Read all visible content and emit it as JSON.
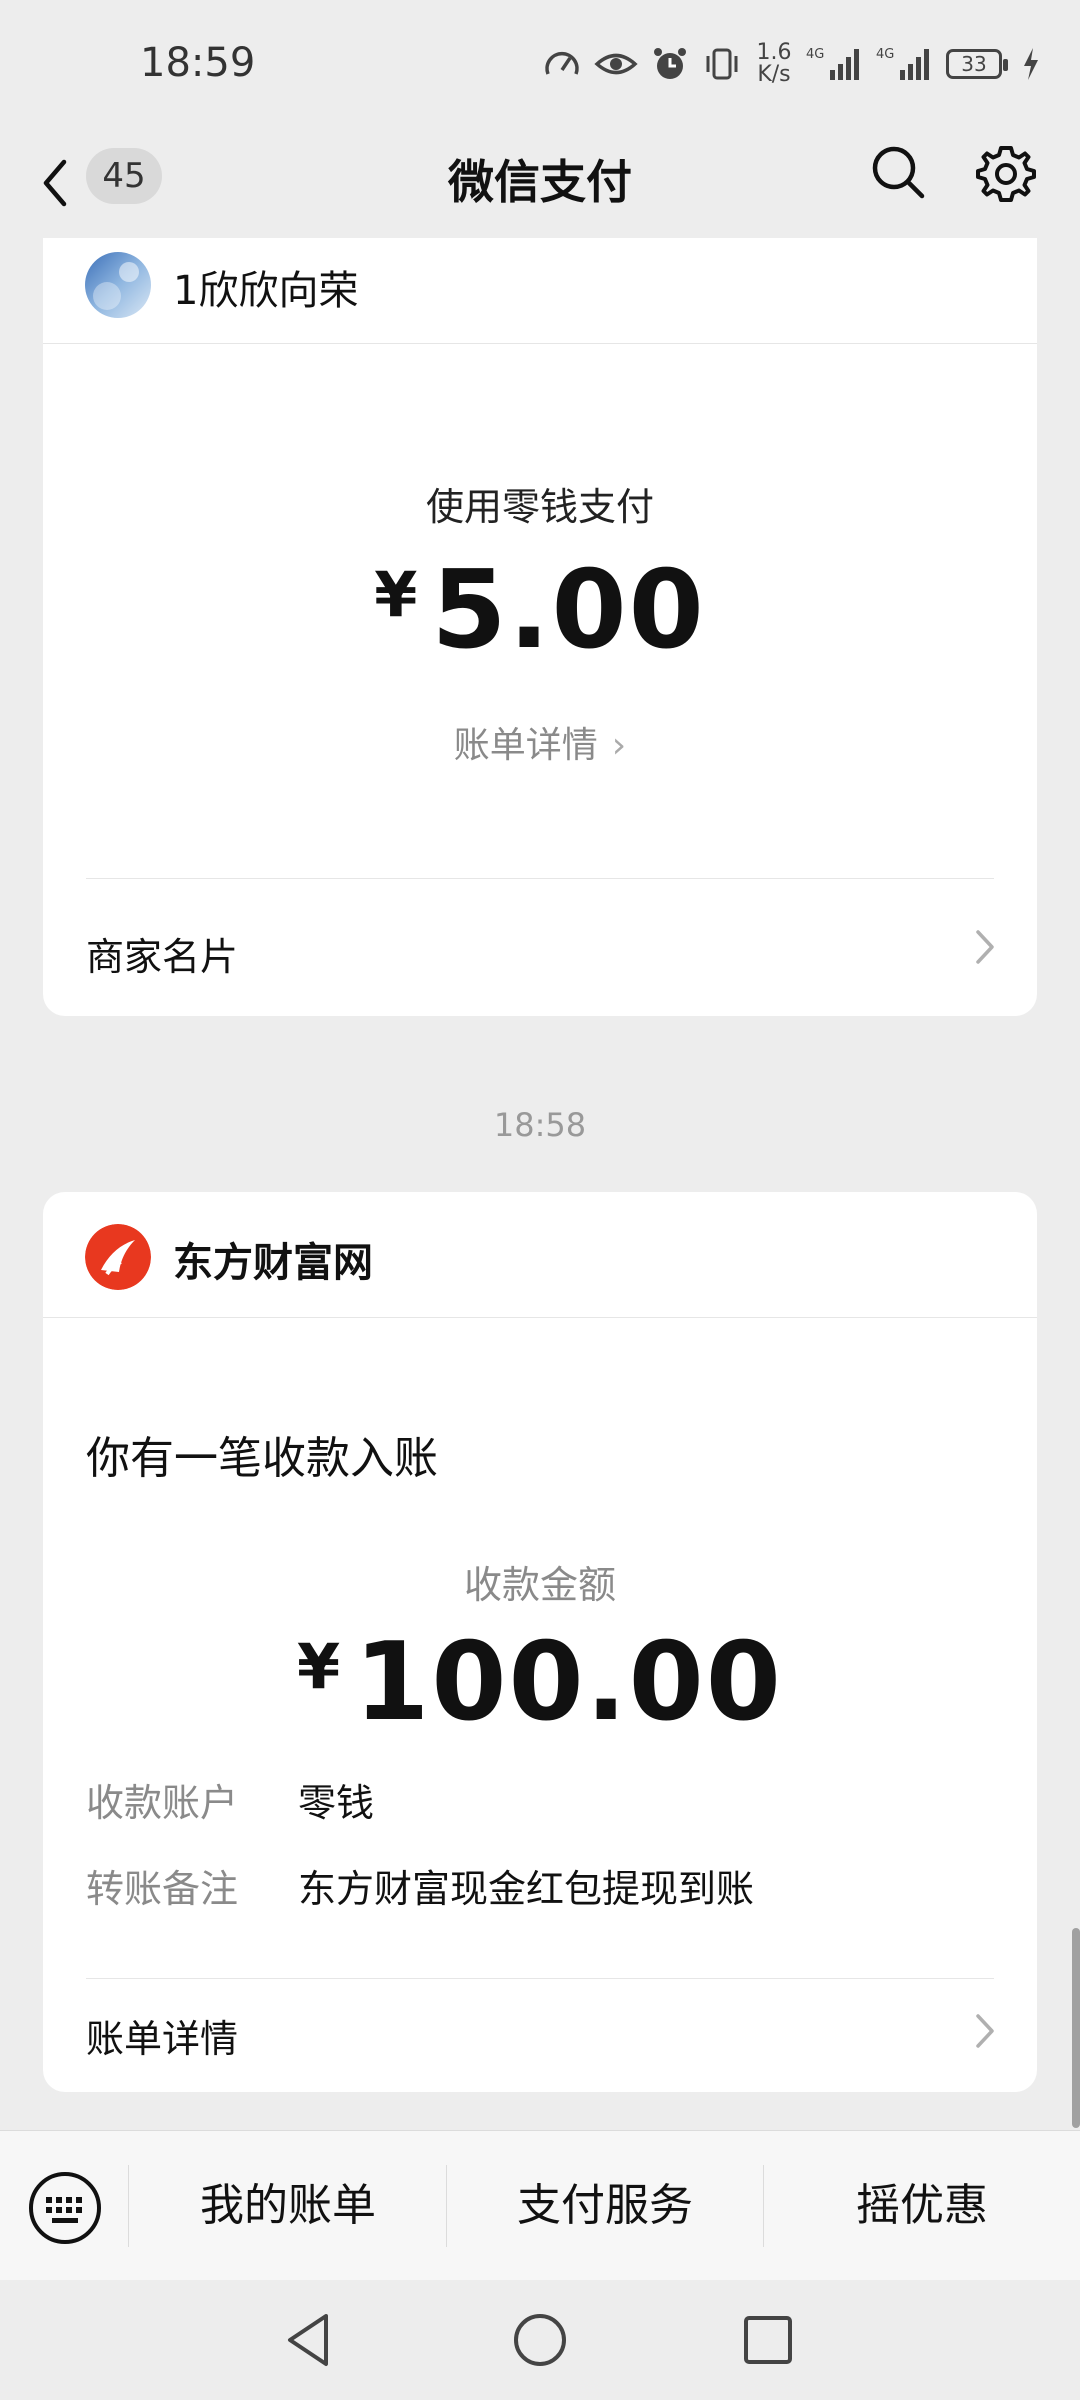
{
  "status_bar": {
    "time": "18:59",
    "net_speed_value": "1.6",
    "net_speed_unit": "K/s",
    "battery": "33"
  },
  "nav": {
    "badge": "45",
    "title": "微信支付"
  },
  "card1": {
    "merchant": "1欣欣向荣",
    "pay_label": "使用零钱支付",
    "currency": "¥",
    "amount": "5.00",
    "detail_link": "账单详情",
    "merchant_card": "商家名片"
  },
  "section_time": "18:58",
  "card2": {
    "merchant": "东方财富网",
    "notice_title": "你有一笔收款入账",
    "sum_label": "收款金额",
    "currency": "¥",
    "amount": "100.00",
    "rows": [
      {
        "key": "收款账户",
        "value": "零钱"
      },
      {
        "key": "转账备注",
        "value": "东方财富现金红包提现到账"
      }
    ],
    "detail": "账单详情"
  },
  "bottom_menu": {
    "items": [
      "我的账单",
      "支付服务",
      "摇优惠"
    ]
  },
  "colors": {
    "background": "#ededed",
    "card": "#ffffff",
    "secondary_text": "#8a8a8a",
    "brand_red": "#e8381f"
  }
}
